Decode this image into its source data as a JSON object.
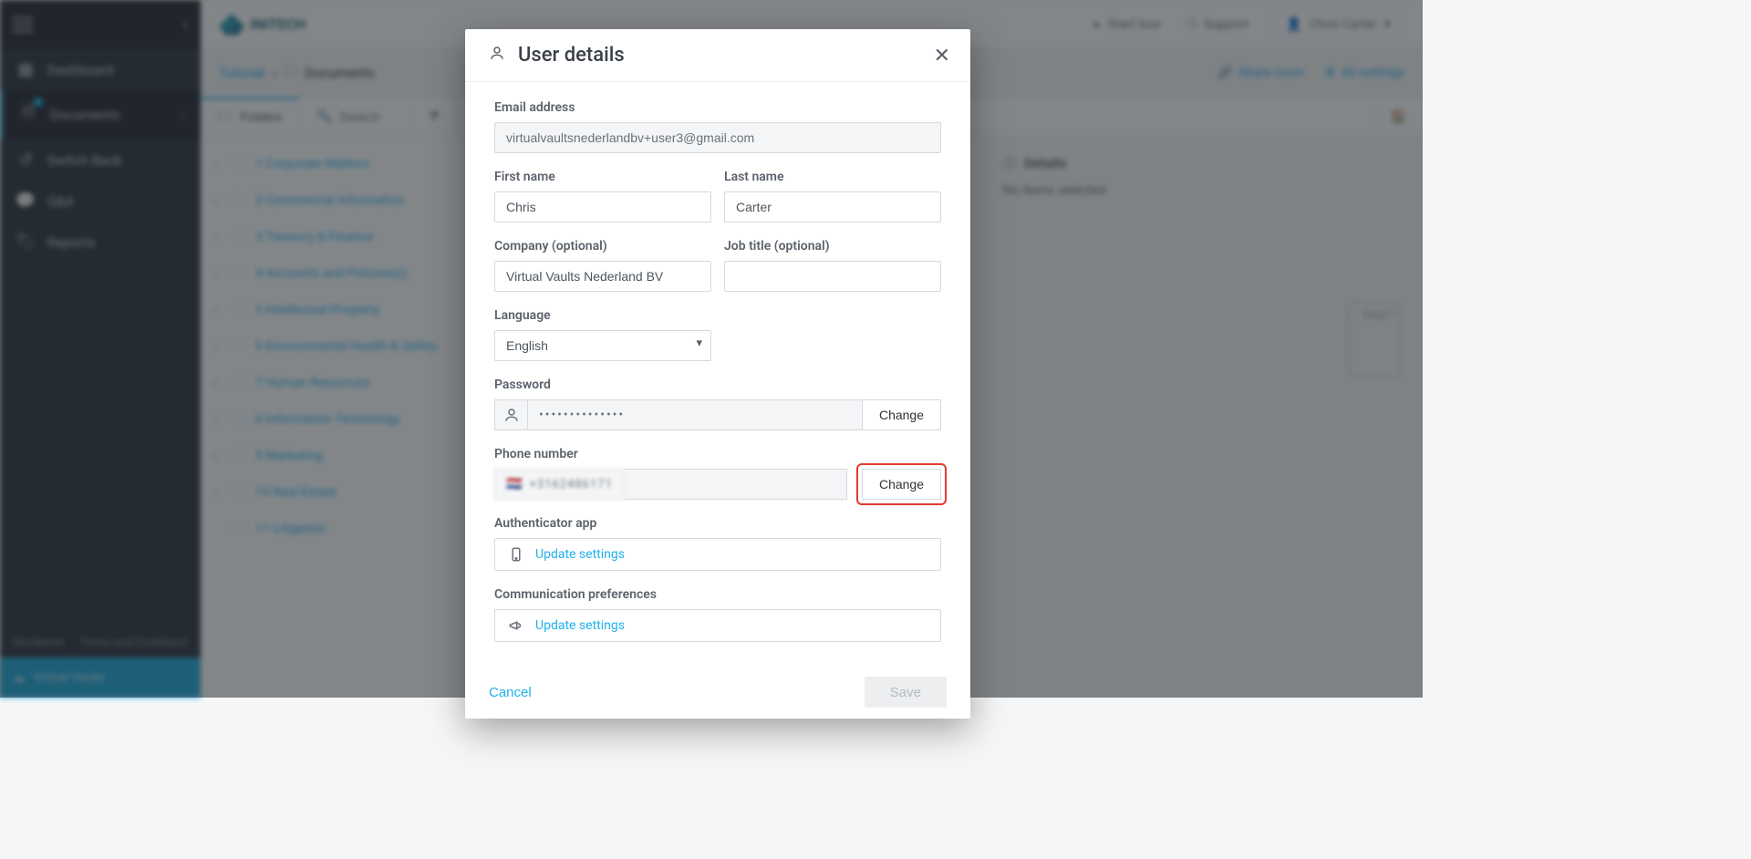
{
  "brand": {
    "name": "INITECH",
    "footer_brand": "Virtual Vaults"
  },
  "sidebar": {
    "items": [
      {
        "icon": "grid",
        "label": "Dashboard"
      },
      {
        "icon": "file",
        "label": "Documents"
      },
      {
        "icon": "swap",
        "label": "Switch Back"
      },
      {
        "icon": "chat",
        "label": "Q&A"
      },
      {
        "icon": "report",
        "label": "Reports"
      }
    ],
    "footer_links": [
      "Disclaimer",
      "Terms and Conditions"
    ]
  },
  "topbar": {
    "start_tour": "Start tour",
    "support": "Support",
    "user_name": "Chris Carter"
  },
  "breadcrumb": {
    "root": "Tutorial",
    "current": "Documents"
  },
  "right_actions": {
    "share": "Share room",
    "settings": "All settings"
  },
  "toolbar": {
    "folders": "Folders",
    "search_placeholder": "Search",
    "filter_label": ""
  },
  "tree": [
    "1 Corporate Matters",
    "2 Commercial Information",
    "3 Treasury & Finance",
    "4 Accounts and Policies(s)",
    "5 Intellectual Property",
    "6 Environmental Health & Safety",
    "7 Human Resources",
    "8 Information Technology",
    "9 Marketing",
    "10 Real Estate",
    "11 Litigation"
  ],
  "details_panel": {
    "title": "Details",
    "empty": "No items selected",
    "drop_label": "Drop"
  },
  "modal": {
    "title": "User details",
    "email_label": "Email address",
    "email_value": "virtualvaultsnederlandbv+user3@gmail.com",
    "first_name_label": "First name",
    "first_name_value": "Chris",
    "last_name_label": "Last name",
    "last_name_value": "Carter",
    "company_label": "Company (optional)",
    "company_value": "Virtual Vaults Nederland BV",
    "job_label": "Job title (optional)",
    "job_value": "",
    "language_label": "Language",
    "language_value": "English",
    "password_label": "Password",
    "password_masked": "••••••••••••••",
    "password_change": "Change",
    "phone_label": "Phone number",
    "phone_masked": "+3162486171",
    "phone_change": "Change",
    "auth_label": "Authenticator app",
    "auth_link": "Update settings",
    "comm_label": "Communication preferences",
    "comm_link": "Update settings",
    "cancel": "Cancel",
    "save": "Save"
  }
}
